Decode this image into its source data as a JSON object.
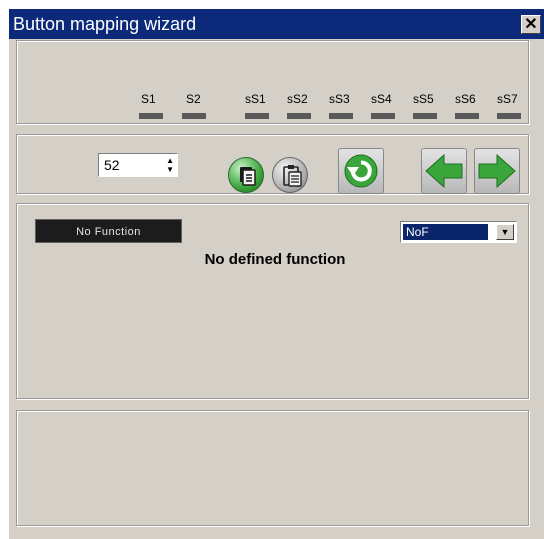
{
  "window": {
    "title": "Button mapping wizard",
    "close_glyph": "✕"
  },
  "switches": [
    {
      "label": "S1"
    },
    {
      "label": "S2"
    },
    {
      "label": "sS1"
    },
    {
      "label": "sS2"
    },
    {
      "label": "sS3"
    },
    {
      "label": "sS4"
    },
    {
      "label": "sS5"
    },
    {
      "label": "sS6"
    },
    {
      "label": "sS7"
    }
  ],
  "toolbar": {
    "button_index": "52",
    "copy_icon": "copy-icon",
    "paste_icon": "paste-icon",
    "reset_icon": "refresh-icon",
    "prev_icon": "arrow-left-icon",
    "next_icon": "arrow-right-icon"
  },
  "function": {
    "name_label": "No Function",
    "description": "No defined function",
    "select_value": "NoF"
  },
  "colors": {
    "accent_green": "#3aa53a",
    "title_bar": "#0d2a7a",
    "selection": "#0a246a"
  }
}
